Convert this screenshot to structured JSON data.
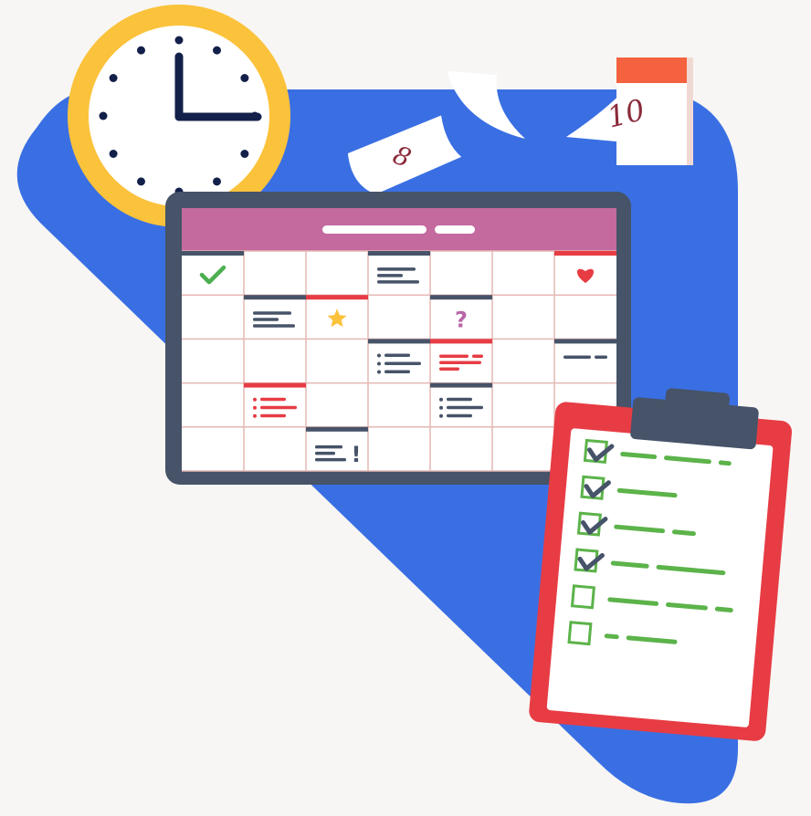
{
  "colors": {
    "background": "#f7f6f4",
    "blob": "#3a6fe3",
    "clock_ring": "#fbc23c",
    "clock_face": "#ffffff",
    "clock_hands": "#13204a",
    "calendar_frame": "#465368",
    "calendar_header": "#c46a9e",
    "grid_line": "#e4b8b4",
    "accent_red": "#e73c44",
    "dark_line": "#465368",
    "check_green": "#4caf50",
    "star_yellow": "#fbc23c",
    "question_purple": "#b868a8",
    "heart_red": "#e73c44",
    "clipboard": "#e73c44",
    "clipboard_clip": "#465368",
    "list_green": "#5cb34a",
    "tearoff_header": "#f4623f"
  },
  "flying_pages": {
    "page_8": "8",
    "page_10": "10",
    "tearoff_visible": "1"
  },
  "calendar": {
    "cells": [
      {
        "icon": "check-icon"
      },
      {},
      {},
      {
        "icon": "lines"
      },
      {},
      {},
      {
        "icon": "heart-icon"
      },
      {},
      {
        "icon": "lines"
      },
      {
        "icon": "star-icon"
      },
      {},
      {
        "icon": "question-icon"
      },
      {},
      {},
      {},
      {},
      {},
      {
        "icon": "bullets"
      },
      {
        "icon": "red-lines"
      },
      {},
      {
        "icon": "dashes"
      },
      {},
      {
        "icon": "red-bullets"
      },
      {},
      {},
      {
        "icon": "bullets"
      },
      {},
      {},
      {},
      {},
      {
        "icon": "exclamation-icon"
      },
      {},
      {},
      {},
      {}
    ],
    "question_mark": "?",
    "exclamation_mark": "!"
  },
  "checklist": {
    "items": [
      {
        "checked": true
      },
      {
        "checked": true
      },
      {
        "checked": true
      },
      {
        "checked": true
      },
      {
        "checked": false
      },
      {
        "checked": false
      }
    ]
  }
}
